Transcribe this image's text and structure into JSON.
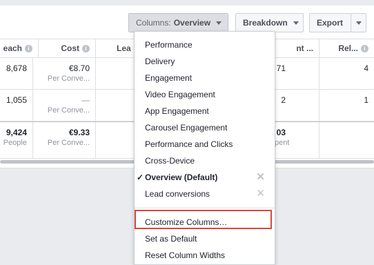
{
  "toolbar": {
    "columns_label": "Columns:",
    "columns_value": "Overview",
    "breakdown_label": "Breakdown",
    "export_label": "Export"
  },
  "table": {
    "headers": [
      "each",
      "Cost",
      "Lea",
      "nt ...",
      "Rel..."
    ],
    "rows": [
      {
        "reach": "8,678",
        "cost": "€8.70",
        "cost_sub": "Per Conve...",
        "amount": "71",
        "amount_sub": "",
        "rel": "4"
      },
      {
        "reach": "1,055",
        "cost": "—",
        "cost_sub": "Per Conve...",
        "amount": "2",
        "amount_sub": "",
        "rel": "1"
      }
    ],
    "total": {
      "reach": "9,424",
      "reach_sub": "People",
      "cost": "€9.33",
      "cost_sub": "Per Conve...",
      "amount": "03",
      "amount_sub": "pent"
    }
  },
  "menu": {
    "items": [
      "Performance",
      "Delivery",
      "Engagement",
      "Video Engagement",
      "App Engagement",
      "Carousel Engagement",
      "Performance and Clicks",
      "Cross-Device",
      "Overview (Default)",
      "Lead conversions"
    ],
    "check_mark": "✓",
    "remove_mark": "✕",
    "actions": [
      "Customize Columns…",
      "Set as Default",
      "Reset Column Widths"
    ]
  },
  "colors": {
    "highlight": "#d9473c",
    "accent": "#4b4f56"
  }
}
